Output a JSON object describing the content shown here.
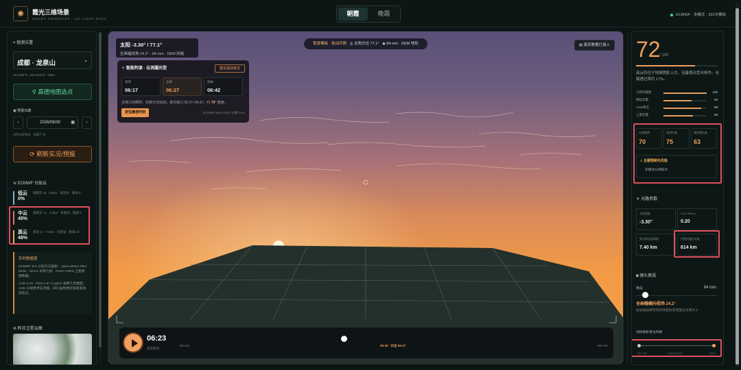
{
  "header": {
    "logo_icon": "sun-cloud-icon",
    "title": "霞光三维场景",
    "subtitle": "SMART FORECAST · 3D LIGHT PATH",
    "tabs": [
      "朝霞",
      "晚霞"
    ],
    "active_tab": "朝霞",
    "status": "ECMWF · 多模式 · 320次模拟"
  },
  "left": {
    "location_title": "观测位置",
    "location_value": "成都 · 龙泉山",
    "coords": [
      "30.5200°N",
      "104.3100°E",
      "786m"
    ],
    "map_button": "高德地图选点",
    "date_title": "预报日期",
    "date_value": "2026/08/30",
    "date_note": "8月30日周日 · 采集了天",
    "refresh_button": "刷新实况/预报",
    "cloud_title": "ECMWF 分层云",
    "clouds": [
      {
        "name": "低云",
        "pct": "0%",
        "desc": "碎积云 St · 0.6km · 未见光 · 衰减 0",
        "color": "#8fb0c8"
      },
      {
        "name": "中云",
        "pct": "45%",
        "desc": "高积云 Ac · 2.2km · 未受光 · 衰减 0",
        "color": "#e57070"
      },
      {
        "name": "高云",
        "pct": "48%",
        "desc": "卷云 Ci · 7.4km · 已受光 · 衰减 19",
        "color": "#f0b060"
      }
    ],
    "info_title": "实时数据源",
    "info_body": "ECMWF IFS 分层云与辐射、Open-Meteo 90m DEM、NOAA 太阳几何、NASA VIIRS 卫星底图数据。",
    "info_body2": "AOD 0.20 · PM2.5 67.3 μg/m³ 通用几何模型；AOD 分级参考实测值，四川盆地地区按高度动态修正。",
    "sat_title": "昨日卫星云图"
  },
  "view": {
    "sun_line1": "太阳 -3.30° / 77.1°",
    "sun_line2": "全画幅视角 24.2° · 84 mm · DEM 网格",
    "pill_left": "取景模板 · 拖动环顾",
    "pill_mid": "太阳方位 77.1°",
    "pill_right": "84 mm · DEM 地形",
    "compare_button": "真实数据已接入",
    "ai_title": "智能判读 · 云洞漏光型",
    "ai_tag": "建议提前就位",
    "times": [
      {
        "label": "黎明",
        "value": "06:17"
      },
      {
        "label": "主峰",
        "value": "06:27"
      },
      {
        "label": "晚峰",
        "value": "06:42"
      }
    ],
    "ai_line": "文档几何规则：仅统计日出前；受光窗口 06:27–06:37。约",
    "ai_line_angle": "78°",
    "ai_line_end": "角度。",
    "position_button": "定位最佳时刻",
    "match_text": "ECMWF Best Match 分数 34%",
    "play_time": "06:23",
    "play_label": "北京时间",
    "minus": "-60 min",
    "window": "06:30 · 日出 06:37",
    "plus": "+60 min"
  },
  "right": {
    "score": "72",
    "score_max": "/ 100",
    "score_pct": 0.72,
    "desc": "高云仍位于地球阴影上方，且备霞光受光条件。光路透过率约 17%。",
    "metrics": [
      {
        "label": "几何可能性",
        "value": "100",
        "pct": 1.0
      },
      {
        "label": "目标云量",
        "value": "65",
        "pct": 0.65
      },
      {
        "label": "AOD清洁",
        "value": "88",
        "pct": 0.88
      },
      {
        "label": "上游云量",
        "value": "68",
        "pct": 0.68
      }
    ],
    "stats": [
      {
        "label": "出现概率",
        "value": "70"
      },
      {
        "label": "观测价值",
        "value": "75"
      },
      {
        "label": "模拟置信度",
        "value": "63"
      }
    ],
    "risk_title": "主要限制与风险",
    "risk_desc": "多模式分歧较大",
    "optics_title": "光路参数",
    "optics": [
      {
        "label": "太阳高度",
        "value": "-3.30°"
      },
      {
        "label": "AOD 550nm",
        "value": "0.20"
      },
      {
        "label": "到当前云底高度",
        "value": "7.40 km"
      },
      {
        "label": "中国光路总长度",
        "value": "614 km"
      }
    ],
    "lens_title": "镜头焦段",
    "focal_label": "焦段",
    "focal_value": "84 mm",
    "focal_pct": 0.08,
    "fov": "全画幅横向视场 24.2°",
    "fov_desc": "拉动焦段即可同步改变取景范围与太阳大小",
    "keyframe_title": "地球阴影受光判断",
    "kf_labels": [
      "高于云底",
      "地影遮挡判定",
      "云受光"
    ]
  }
}
